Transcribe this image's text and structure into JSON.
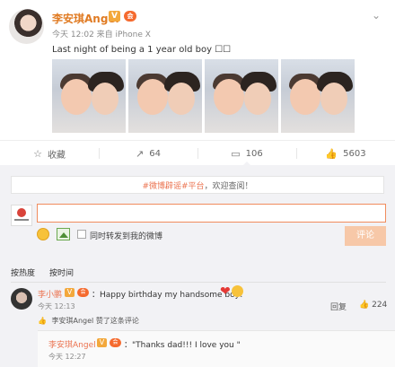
{
  "post": {
    "username": "李安琪Angel",
    "meta": "今天 12:02 来自 iPhone X",
    "text": "Last night of being a 1 year old boy ☐☐"
  },
  "actions": {
    "favorite": "收藏",
    "repost": "64",
    "comment": "106",
    "like": "5603"
  },
  "comments": {
    "notice_tag": "#微博辟谣#平台",
    "notice_text": "，欢迎查阅！",
    "input_value": "",
    "also_repost": "同时转发到我的微博",
    "submit": "评论",
    "sort_hot": "按热度",
    "sort_time": "按时间",
    "items": [
      {
        "user": "李小鹏",
        "text": "：Happy birthday my handsome boy!",
        "time": "今天 12:13",
        "reply": "回复",
        "likes": "224",
        "liked_by": "李安琪Angel 赞了这条评论",
        "reply_user": "李安琪Angel",
        "reply_text": "：\"Thanks dad!!! I love you \"",
        "reply_time": "今天 12:27"
      }
    ]
  },
  "colors": {
    "accent": "#eb7350",
    "bg": "#f2f2f5"
  }
}
